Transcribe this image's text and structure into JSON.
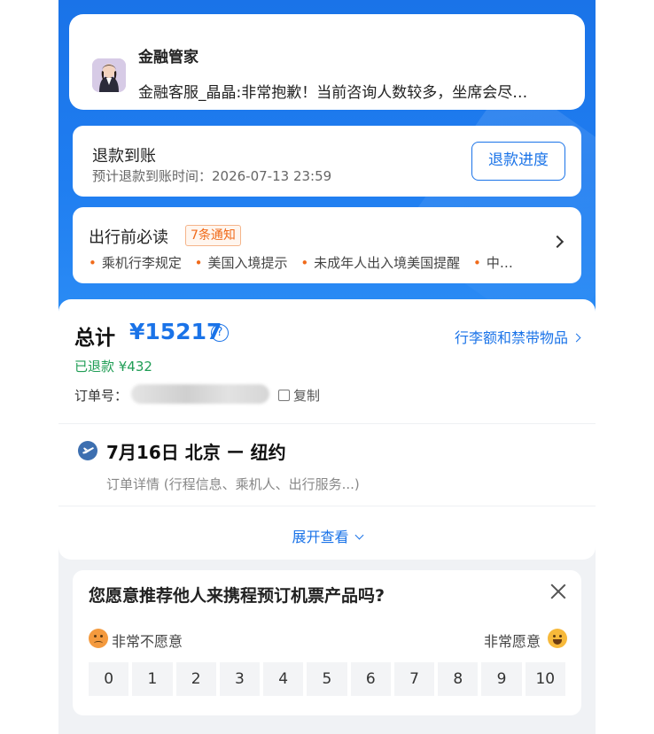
{
  "chat": {
    "title": "金融管家",
    "message": "金融客服_晶晶:非常抱歉！当前咨询人数较多，坐席会尽…"
  },
  "refund": {
    "title": "退款到账",
    "time_text": "预计退款到账时间：2026-07-13 23:59",
    "button": "退款进度"
  },
  "travel": {
    "title": "出行前必读",
    "badge": "7条通知",
    "items": [
      "乘机行李规定",
      "美国入境提示",
      "未成年人出入境美国提醒",
      "中…"
    ]
  },
  "order": {
    "total_label": "总计",
    "total_amount": "¥15217",
    "help_icon_text": "?",
    "luggage_link": "行李额和禁带物品",
    "refunded": "已退款 ¥432",
    "order_no_label": "订单号：",
    "copy_label": "复制",
    "flight_title": "7月16日 北京 ー 纽约",
    "flight_detail": "订单详情 (行程信息、乘机人、出行服务...)",
    "expand": "展开查看"
  },
  "survey": {
    "question": "您愿意推荐他人来携程预订机票产品吗?",
    "low_label": "非常不愿意",
    "high_label": "非常愿意",
    "scale": [
      "0",
      "1",
      "2",
      "3",
      "4",
      "5",
      "6",
      "7",
      "8",
      "9",
      "10"
    ]
  },
  "icons": {
    "plane": "plane-icon",
    "close": "close-icon",
    "copy": "copy-icon",
    "help": "help-icon"
  },
  "colors": {
    "brand_blue": "#1a73e8",
    "badge_orange": "#f06a1a",
    "refund_green": "#1f9d55"
  }
}
